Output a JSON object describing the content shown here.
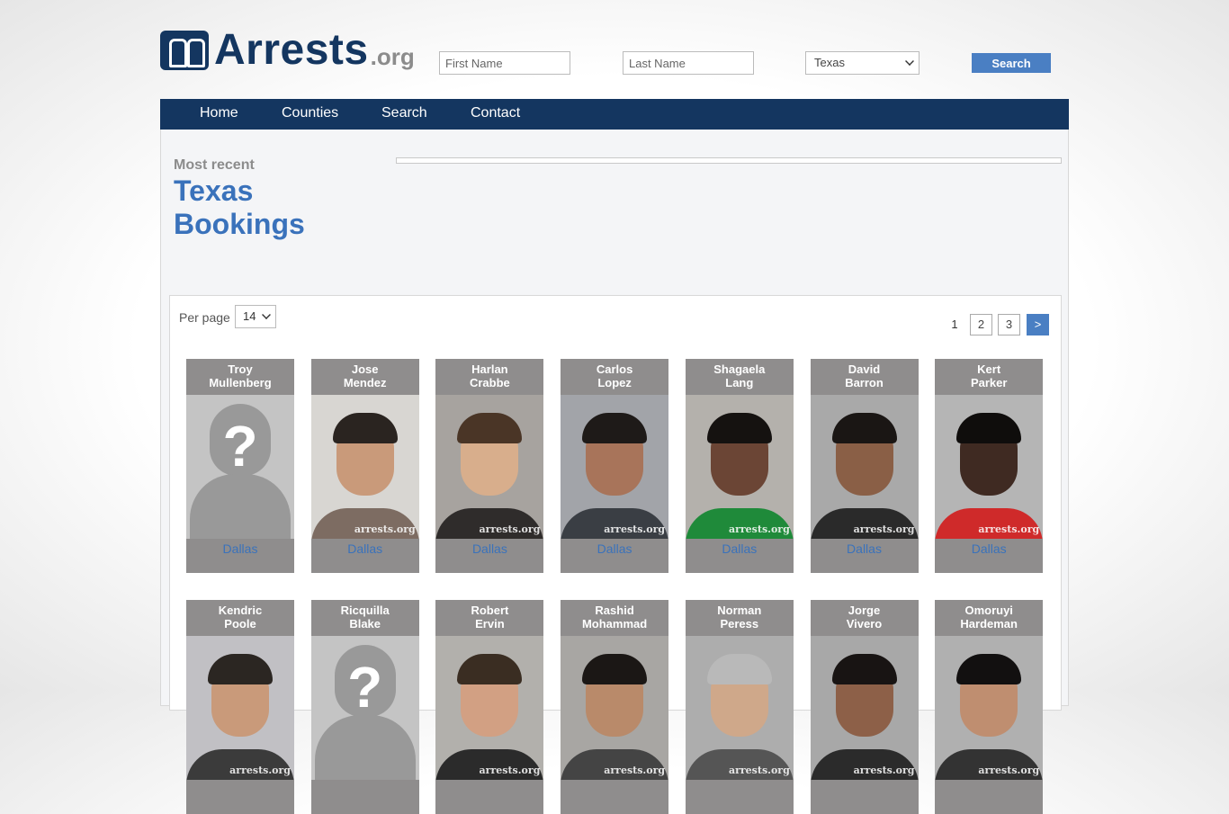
{
  "logo": {
    "main": "Arrests",
    "suffix": ".org"
  },
  "search": {
    "first_placeholder": "First Name",
    "last_placeholder": "Last Name",
    "state_selected": "Texas",
    "button": "Search"
  },
  "nav": [
    "Home",
    "Counties",
    "Search",
    "Contact"
  ],
  "heading": {
    "kicker": "Most recent",
    "title_line1": "Texas",
    "title_line2": "Bookings"
  },
  "listing": {
    "per_page_label": "Per page",
    "per_page_value": "14",
    "pagination": {
      "current": "1",
      "pages": [
        "2",
        "3"
      ],
      "next": ">"
    }
  },
  "watermark": "arrests.org",
  "people": [
    {
      "first": "Troy",
      "last": "Mullenberg",
      "county": "Dallas",
      "photo": "unknown"
    },
    {
      "first": "Jose",
      "last": "Mendez",
      "county": "Dallas",
      "photo": "face"
    },
    {
      "first": "Harlan",
      "last": "Crabbe",
      "county": "Dallas",
      "photo": "face"
    },
    {
      "first": "Carlos",
      "last": "Lopez",
      "county": "Dallas",
      "photo": "face"
    },
    {
      "first": "Shagaela",
      "last": "Lang",
      "county": "Dallas",
      "photo": "face"
    },
    {
      "first": "David",
      "last": "Barron",
      "county": "Dallas",
      "photo": "face"
    },
    {
      "first": "Kert",
      "last": "Parker",
      "county": "Dallas",
      "photo": "face"
    },
    {
      "first": "Kendric",
      "last": "Poole",
      "county": "",
      "photo": "face"
    },
    {
      "first": "Ricquilla",
      "last": "Blake",
      "county": "",
      "photo": "unknown"
    },
    {
      "first": "Robert",
      "last": "Ervin",
      "county": "",
      "photo": "face"
    },
    {
      "first": "Rashid",
      "last": "Mohammad",
      "county": "",
      "photo": "face"
    },
    {
      "first": "Norman",
      "last": "Peress",
      "county": "",
      "photo": "face"
    },
    {
      "first": "Jorge",
      "last": "Vivero",
      "county": "",
      "photo": "face"
    },
    {
      "first": "Omoruyi",
      "last": "Hardeman",
      "county": "",
      "photo": "face"
    }
  ],
  "colors": {
    "brand": "#143660",
    "accent": "#4a7fc3",
    "title": "#3a72bb",
    "card": "#8f8d8d"
  }
}
